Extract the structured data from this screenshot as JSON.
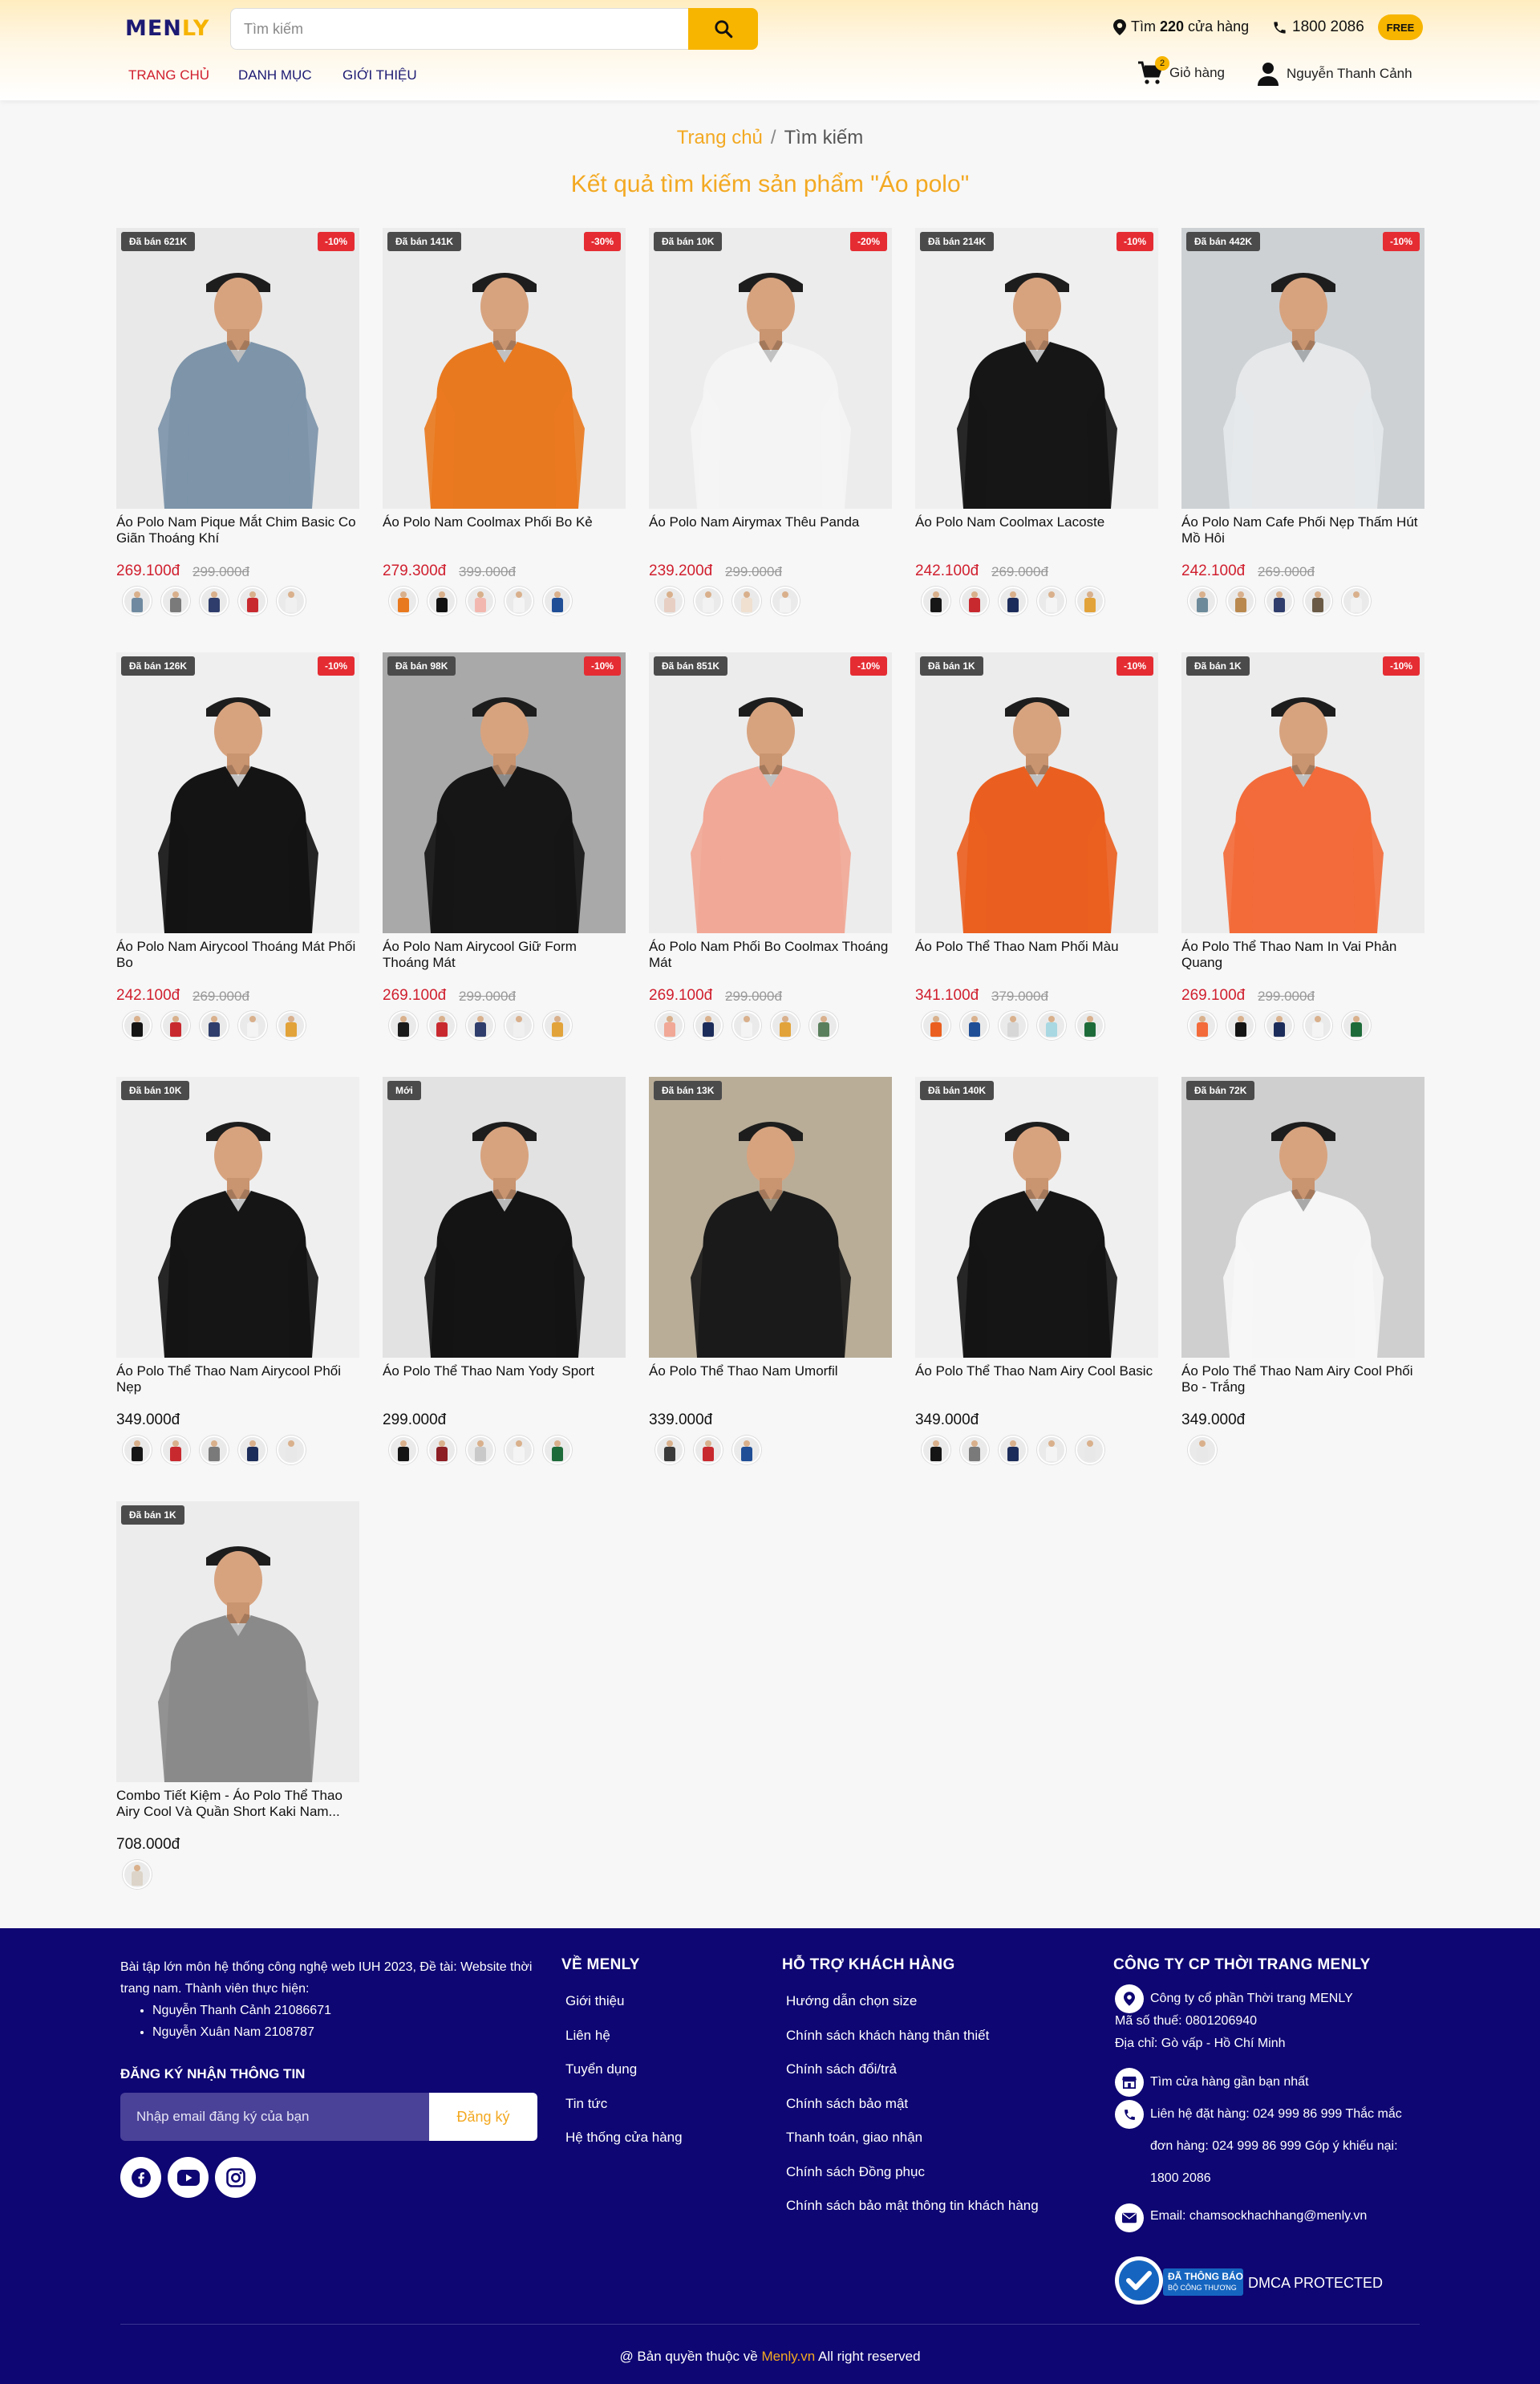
{
  "header": {
    "logo_main": "MEN",
    "logo_accent": "LY",
    "search_placeholder": "Tìm kiếm",
    "stores_prefix": "Tìm ",
    "stores_count": "220",
    "stores_suffix": " cửa hàng",
    "hotline": "1800 2086",
    "free_badge": "FREE",
    "nav": [
      "TRANG CHỦ",
      "DANH MỤC",
      "GIỚI THIỆU"
    ],
    "cart_label": "Giỏ hàng",
    "cart_count": "2",
    "user_name": "Nguyễn Thanh Cảnh"
  },
  "breadcrumb": {
    "home": "Trang chủ",
    "separator": "/",
    "current": "Tìm kiếm"
  },
  "result_title": "Kết quả tìm kiếm sản phẩm \"Áo polo\"",
  "products": [
    {
      "sold": "Đã bán 621K",
      "discount": "-10%",
      "name": "Áo Polo Nam Pique Mắt Chim Basic Co Giãn Thoáng Khí",
      "price": "269.100đ",
      "old_price": "299.000đ",
      "shirt": "#7d94a9",
      "bg": "#e9e9e9",
      "swatches": [
        "#6f8aa0",
        "#7a7a7a",
        "#2e3d6b",
        "#c8292f",
        "#f0f0f0"
      ]
    },
    {
      "sold": "Đã bán 141K",
      "discount": "-30%",
      "name": "Áo Polo Nam Coolmax Phối Bo Kẻ",
      "price": "279.300đ",
      "old_price": "399.000đ",
      "shirt": "#e9791f",
      "bg": "#ececec",
      "swatches": [
        "#e9791f",
        "#111111",
        "#f2b8b0",
        "#f4f4f4",
        "#1f4e96"
      ]
    },
    {
      "sold": "Đã bán 10K",
      "discount": "-20%",
      "name": "Áo Polo Nam Airymax Thêu Panda",
      "price": "239.200đ",
      "old_price": "299.000đ",
      "shirt": "#f4f4f4",
      "bg": "#ececec",
      "swatches": [
        "#e7cfc4",
        "#f2f2f2",
        "#efe0d0",
        "#f3f3f3"
      ]
    },
    {
      "sold": "Đã bán 214K",
      "discount": "-10%",
      "name": "Áo Polo Nam Coolmax Lacoste",
      "price": "242.100đ",
      "old_price": "269.000đ",
      "shirt": "#161616",
      "bg": "#efefef",
      "swatches": [
        "#161616",
        "#c8292f",
        "#1c2c5a",
        "#f4f4f4",
        "#e2a33a"
      ]
    },
    {
      "sold": "Đã bán 442K",
      "discount": "-10%",
      "name": "Áo Polo Nam Cafe Phối Nẹp Thấm Hút Mồ Hôi",
      "price": "242.100đ",
      "old_price": "269.000đ",
      "shirt": "#e6e8ea",
      "bg": "#cdd1d4",
      "swatches": [
        "#6c8a9a",
        "#b9884f",
        "#2e3d6b",
        "#6a5a45",
        "#f2f2f2"
      ]
    },
    {
      "sold": "Đã bán 126K",
      "discount": "-10%",
      "name": "Áo Polo Nam Airycool Thoáng Mát Phối Bo",
      "price": "242.100đ",
      "old_price": "269.000đ",
      "shirt": "#141414",
      "bg": "#efefef",
      "swatches": [
        "#141414",
        "#c8292f",
        "#2e3d6b",
        "#f4f4f4",
        "#e2a33a"
      ]
    },
    {
      "sold": "Đã bán 98K",
      "discount": "-10%",
      "name": "Áo Polo Nam Airycool Giữ Form Thoáng Mát",
      "price": "269.100đ",
      "old_price": "299.000đ",
      "shirt": "#161616",
      "bg": "#a9a9a9",
      "swatches": [
        "#1a1a1a",
        "#c8292f",
        "#2e3d6b",
        "#f0f0f0",
        "#e2a33a"
      ]
    },
    {
      "sold": "Đã bán 851K",
      "discount": "-10%",
      "name": "Áo Polo Nam Phối Bo Coolmax Thoáng Mát",
      "price": "269.100đ",
      "old_price": "299.000đ",
      "shirt": "#f1a896",
      "bg": "#ececec",
      "swatches": [
        "#f1a896",
        "#1c2c5a",
        "#f4f4f4",
        "#e2a33a",
        "#5a7f5c"
      ]
    },
    {
      "sold": "Đã bán 1K",
      "discount": "-10%",
      "name": "Áo Polo Thể Thao Nam Phối Màu",
      "price": "341.100đ",
      "old_price": "379.000đ",
      "shirt": "#ea5f1f",
      "bg": "#ececec",
      "swatches": [
        "#ea5f1f",
        "#1f4e96",
        "#d7d7d7",
        "#a9d8e2",
        "#1e6b3a"
      ]
    },
    {
      "sold": "Đã bán 1K",
      "discount": "-10%",
      "name": "Áo Polo Thể Thao Nam In Vai Phản Quang",
      "price": "269.100đ",
      "old_price": "299.000đ",
      "shirt": "#f36b3a",
      "bg": "#ececec",
      "swatches": [
        "#f36b3a",
        "#141414",
        "#1c2c5a",
        "#f4f4f4",
        "#1e6b3a"
      ]
    },
    {
      "sold": "Đã bán 10K",
      "discount": "",
      "name": "Áo Polo Thể Thao Nam Airycool Phối Nẹp",
      "price": "349.000đ",
      "old_price": "",
      "shirt": "#151515",
      "bg": "#efefef",
      "swatches": [
        "#151515",
        "#c8292f",
        "#7a7a7a",
        "#1c2c5a",
        "#e8e8e8"
      ]
    },
    {
      "sold": "Mới",
      "discount": "",
      "name": "Áo Polo Thể Thao Nam Yody Sport",
      "price": "299.000đ",
      "old_price": "",
      "shirt": "#141414",
      "bg": "#e2e2e2",
      "swatches": [
        "#141414",
        "#8c1e24",
        "#c9c9c9",
        "#f4f4f4",
        "#1e6b3a"
      ]
    },
    {
      "sold": "Đã bán 13K",
      "discount": "",
      "name": "Áo Polo Thể Thao Nam Umorfil",
      "price": "339.000đ",
      "old_price": "",
      "shirt": "#1a1a1a",
      "bg": "#b9ad98",
      "swatches": [
        "#3a3a3a",
        "#c8292f",
        "#1f4e96"
      ]
    },
    {
      "sold": "Đã bán 140K",
      "discount": "",
      "name": "Áo Polo Thể Thao Nam Airy Cool Basic",
      "price": "349.000đ",
      "old_price": "",
      "shirt": "#151515",
      "bg": "#efefef",
      "swatches": [
        "#151515",
        "#7a7a7a",
        "#1c2c5a",
        "#f4f4f4",
        "#e8e8e8"
      ]
    },
    {
      "sold": "Đã bán 72K",
      "discount": "",
      "name": "Áo Polo Thể Thao Nam Airy Cool Phối Bo - Trắng",
      "price": "349.000đ",
      "old_price": "",
      "shirt": "#f6f6f6",
      "bg": "#cfcfcf",
      "swatches": [
        "#e8e8e8"
      ]
    },
    {
      "sold": "Đã bán 1K",
      "discount": "",
      "name": "Combo Tiết Kiệm - Áo Polo Thể Thao Airy Cool Và Quần Short Kaki Nam...",
      "price": "708.000đ",
      "old_price": "",
      "shirt": "#8a8a8a",
      "bg": "#ececec",
      "swatches": [
        "#dcd4c8"
      ]
    }
  ],
  "footer": {
    "about": "Bài tập lớn môn hệ thống công nghệ web IUH 2023, Đề tài: Website thời trang nam. Thành viên thực hiện:",
    "members": [
      "Nguyễn Thanh Cảnh 21086671",
      "Nguyễn Xuân Nam 2108787"
    ],
    "subscribe_title": "ĐĂNG KÝ NHẬN THÔNG TIN",
    "subscribe_placeholder": "Nhập email đăng ký của bạn",
    "subscribe_button": "Đăng ký",
    "col_about_title": "VỀ MENLY",
    "col_about_links": [
      "Giới thiệu",
      "Liên hệ",
      "Tuyển dụng",
      "Tin tức",
      "Hệ thống cửa hàng"
    ],
    "col_support_title": "HỖ TRỢ KHÁCH HÀNG",
    "col_support_links": [
      "Hướng dẫn chọn size",
      "Chính sách khách hàng thân thiết",
      "Chính sách đổi/trả",
      "Chính sách bảo mật",
      "Thanh toán, giao nhận",
      "Chính sách Đồng phục",
      "Chính sách bảo mật thông tin khách hàng"
    ],
    "company_title": "CÔNG TY CP THỜI TRANG MENLY",
    "company_name": "Công ty cổ phần Thời trang MENLY",
    "tax_code": "Mã số thuế: 0801206940",
    "address": "Địa chỉ: Gò vấp - Hồ Chí Minh",
    "store_finder": "Tìm cửa hàng gần bạn nhất",
    "contact": "Liên hệ đặt hàng: 024 999 86 999 Thắc mắc đơn hàng: 024 999 86 999 Góp ý khiếu nại: 1800 2086",
    "email": "Email: chamsockhachhang@menly.vn",
    "bct_line1": "ĐÃ THÔNG BÁO",
    "bct_line2": "BỘ CÔNG THƯƠNG",
    "dmca": "DMCA PROTECTED",
    "copyright_prefix": "@ Bản quyền thuộc về ",
    "copyright_brand": "Menly.vn",
    "copyright_suffix": " All right reserved"
  },
  "colors": {
    "brand_navy": "#1c1a73",
    "accent_yellow": "#f7b500",
    "sale_red": "#d01f2e",
    "footer_bg": "#0e0672"
  }
}
